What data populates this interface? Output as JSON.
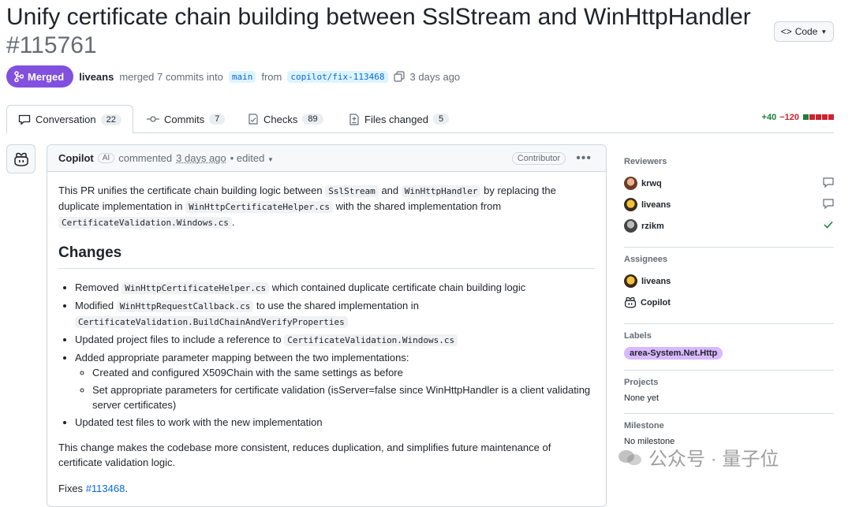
{
  "title": "Unify certificate chain building between SslStream and WinHttpHandler",
  "pr_number": "#115761",
  "code_button": "Code",
  "meta": {
    "status": "Merged",
    "author": "liveans",
    "merged_text": "merged 7 commits into",
    "base_branch": "main",
    "from_text": "from",
    "head_branch": "copilot/fix-113468",
    "time": "3 days ago"
  },
  "tabs": [
    {
      "label": "Conversation",
      "count": "22"
    },
    {
      "label": "Commits",
      "count": "7"
    },
    {
      "label": "Checks",
      "count": "89"
    },
    {
      "label": "Files changed",
      "count": "5"
    }
  ],
  "diffstat": {
    "added": "+40",
    "removed": "−120"
  },
  "comment": {
    "author": "Copilot",
    "ai_badge": "AI",
    "commented": "commented",
    "time": "3 days ago",
    "edited": "• edited",
    "role": "Contributor",
    "intro": {
      "t1": "This PR unifies the certificate chain building logic between",
      "c1": "SslStream",
      "t2": "and",
      "c2": "WinHttpHandler",
      "t3": "by replacing the duplicate implementation in",
      "c3": "WinHttpCertificateHelper.cs",
      "t4": "with the shared implementation from",
      "c4": "CertificateValidation.Windows.cs",
      "t5": "."
    },
    "heading": "Changes",
    "bullets": {
      "b1_text": "Removed",
      "b1_code": "WinHttpCertificateHelper.cs",
      "b1_rest": "which contained duplicate certificate chain building logic",
      "b2_text": "Modified",
      "b2_code": "WinHttpRequestCallback.cs",
      "b2_rest": "to use the shared implementation in",
      "b2_code2": "CertificateValidation.BuildChainAndVerifyProperties",
      "b3_text": "Updated project files to include a reference to",
      "b3_code": "CertificateValidation.Windows.cs",
      "b4_text": "Added appropriate parameter mapping between the two implementations:",
      "b4_sub1": "Created and configured X509Chain with the same settings as before",
      "b4_sub2": "Set appropriate parameters for certificate validation (isServer=false since WinHttpHandler is a client validating server certificates)",
      "b5_text": "Updated test files to work with the new implementation"
    },
    "summary": "This change makes the codebase more consistent, reduces duplication, and simplifies future maintenance of certificate validation logic.",
    "fixes_text": "Fixes",
    "fixes_link": "#113468",
    "fixes_end": "."
  },
  "sidebar": {
    "reviewers_title": "Reviewers",
    "reviewers": [
      "krwq",
      "liveans",
      "rzikm"
    ],
    "assignees_title": "Assignees",
    "assignees": [
      "liveans",
      "Copilot"
    ],
    "labels_title": "Labels",
    "label": "area-System.Net.Http",
    "projects_title": "Projects",
    "projects_value": "None yet",
    "milestone_title": "Milestone",
    "milestone_value": "No milestone"
  },
  "watermark": {
    "text": "公众号 · 量子位"
  },
  "colors": {
    "merged": "#8250df",
    "link": "#0969da",
    "label": "#d8b9ff",
    "add": "#1a7f37",
    "del": "#cf222e"
  }
}
